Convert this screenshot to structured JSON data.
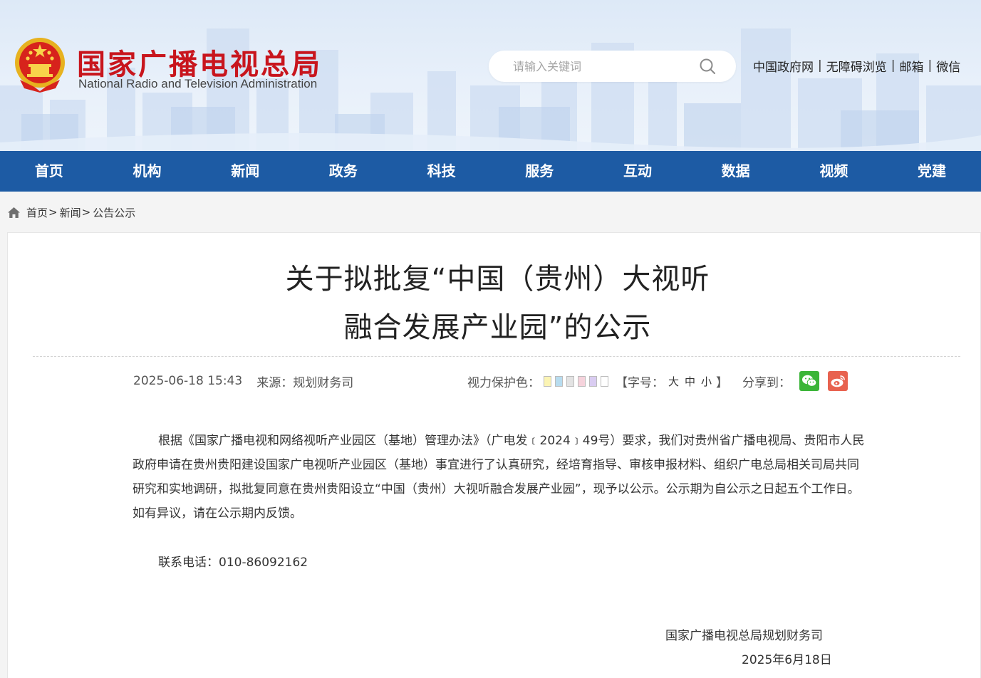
{
  "header": {
    "site_title_cn": "国家广播电视总局",
    "site_title_en": "National Radio and Television Administration",
    "search_placeholder": "请输入关键词",
    "top_links": [
      "中国政府网",
      "无障碍浏览",
      "邮箱",
      "微信"
    ],
    "separator": "|"
  },
  "nav": {
    "items": [
      "首页",
      "机构",
      "新闻",
      "政务",
      "科技",
      "服务",
      "互动",
      "数据",
      "视频",
      "党建"
    ]
  },
  "breadcrumb": {
    "items": [
      "首页",
      "新闻",
      "公告公示"
    ],
    "separator": ">"
  },
  "article": {
    "title_line1": "关于拟批复“中国（贵州）大视听",
    "title_line2": "融合发展产业园”的公示",
    "datetime": "2025-06-18 15:43",
    "source": "来源：规划财务司",
    "eye_protect_label": "视力保护色：",
    "eye_colors": [
      "#fbf4b4",
      "#b7dcef",
      "#e3e3e3",
      "#f6d3dc",
      "#d9ccf1",
      "#ffffff"
    ],
    "font_size_open": "【字号：",
    "font_sizes": [
      "大",
      "中",
      "小"
    ],
    "font_size_close": "】",
    "share_label": "分享到：",
    "paragraph": "根据《国家广播电视和网络视听产业园区（基地）管理办法》（广电发﹝2024﹞49号）要求，我们对贵州省广播电视局、贵阳市人民政府申请在贵州贵阳建设国家广电视听产业园区（基地）事宜进行了认真研究，经培育指导、审核申报材料、组织广电总局相关司局共同研究和实地调研，拟批复同意在贵州贵阳设立“中国（贵州）大视听融合发展产业园”，现予以公示。公示期为自公示之日起五个工作日。如有异议，请在公示期内反馈。",
    "contact": "联系电话：010-86092162",
    "sign_org": "国家广播电视总局规划财务司",
    "sign_date": "2025年6月18日"
  },
  "colors": {
    "brand_red": "#c8151d",
    "nav_blue": "#1d5ba4",
    "wechat_green": "#3bb538",
    "weibo_red": "#e8624f"
  }
}
